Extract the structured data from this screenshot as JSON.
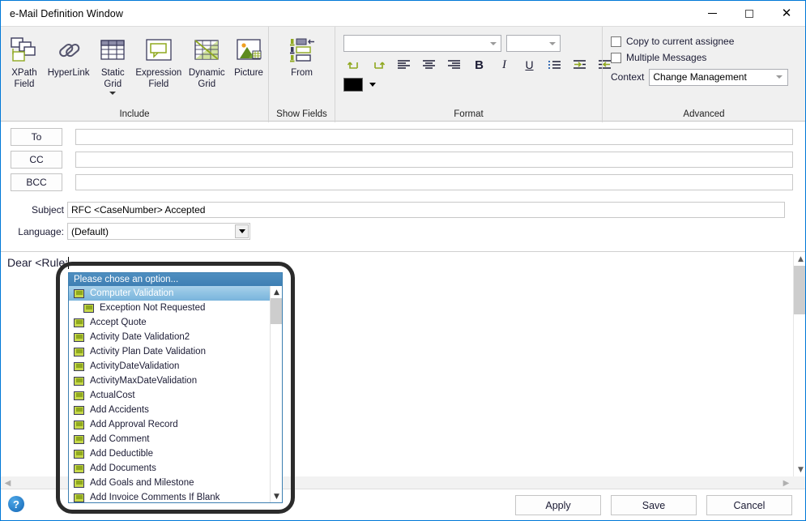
{
  "window": {
    "title": "e-Mail Definition Window",
    "controls": {
      "minimize": "—",
      "maximize": "□",
      "close": "✕"
    }
  },
  "ribbon": {
    "groups": [
      {
        "label": "Include",
        "items": [
          {
            "label_line1": "XPath",
            "label_line2": "Field",
            "icon": "xpath-field-icon"
          },
          {
            "label_line1": "HyperLink",
            "label_line2": "",
            "icon": "hyperlink-icon"
          },
          {
            "label_line1": "Static",
            "label_line2": "Grid",
            "icon": "static-grid-icon",
            "has_caret": true
          },
          {
            "label_line1": "Expression",
            "label_line2": "Field",
            "icon": "expression-field-icon"
          },
          {
            "label_line1": "Dynamic",
            "label_line2": "Grid",
            "icon": "dynamic-grid-icon"
          },
          {
            "label_line1": "Picture",
            "label_line2": "",
            "icon": "picture-icon"
          }
        ]
      },
      {
        "label": "Show Fields",
        "items": [
          {
            "label_line1": "From",
            "label_line2": "",
            "icon": "from-field-icon"
          }
        ]
      },
      {
        "label": "Format",
        "font_name_value": "",
        "font_size_value": "",
        "buttons": [
          {
            "name": "undo",
            "glyph": "↶"
          },
          {
            "name": "redo",
            "glyph": "↷"
          },
          {
            "name": "align-left",
            "glyph": "≡"
          },
          {
            "name": "align-center",
            "glyph": "≡"
          },
          {
            "name": "align-right",
            "glyph": "≡"
          },
          {
            "name": "bold",
            "glyph": "B"
          },
          {
            "name": "italic",
            "glyph": "I"
          },
          {
            "name": "underline",
            "glyph": "U"
          },
          {
            "name": "bullet-list",
            "glyph": "≣"
          },
          {
            "name": "indent-increase",
            "glyph": "→"
          },
          {
            "name": "indent-decrease",
            "glyph": "←"
          }
        ],
        "color_swatch": "#000000"
      },
      {
        "label": "Advanced",
        "checkbox_copy_assignee": "Copy to current assignee",
        "checkbox_multiple_messages": "Multiple Messages",
        "context_label": "Context",
        "context_value": "Change Management"
      }
    ]
  },
  "address": {
    "to_label": "To",
    "to_value": "",
    "cc_label": "CC",
    "cc_value": "",
    "bcc_label": "BCC",
    "bcc_value": "",
    "subject_label": "Subject",
    "subject_value": "RFC <CaseNumber> Accepted",
    "language_label": "Language:",
    "language_value": "(Default)"
  },
  "editor": {
    "body_text": "Dear <Rule:"
  },
  "dropdown": {
    "header": "Please chose an option...",
    "selected_index": 0,
    "items": [
      {
        "label": "Computer Validation",
        "indented": false
      },
      {
        "label": "Exception Not Requested",
        "indented": true
      },
      {
        "label": "Accept Quote",
        "indented": false
      },
      {
        "label": "Activity Date Validation2",
        "indented": false
      },
      {
        "label": "Activity Plan Date Validation",
        "indented": false
      },
      {
        "label": "ActivityDateValidation",
        "indented": false
      },
      {
        "label": "ActivityMaxDateValidation",
        "indented": false
      },
      {
        "label": "ActualCost",
        "indented": false
      },
      {
        "label": "Add Accidents",
        "indented": false
      },
      {
        "label": "Add Approval Record",
        "indented": false
      },
      {
        "label": "Add Comment",
        "indented": false
      },
      {
        "label": "Add Deductible",
        "indented": false
      },
      {
        "label": "Add Documents",
        "indented": false
      },
      {
        "label": "Add Goals and Milestone",
        "indented": false
      },
      {
        "label": "Add Invoice Comments If Blank",
        "indented": false
      }
    ]
  },
  "footer": {
    "help_glyph": "?",
    "apply_label": "Apply",
    "save_label": "Save",
    "cancel_label": "Cancel"
  },
  "colors": {
    "accent": "#0078d7",
    "ribbon_bg": "#f0f0f0",
    "dropdown_header": "#3e7fb3",
    "selection": "#8fc2e3",
    "icon_green": "#8fa81f",
    "icon_navy": "#3b3b5c"
  }
}
